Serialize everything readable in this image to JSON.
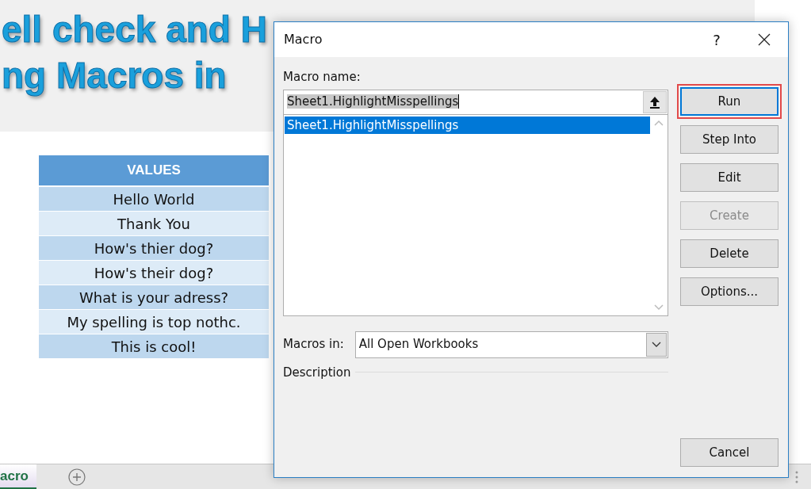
{
  "banner": {
    "lines": [
      "ell check and H",
      "ng Macros in"
    ]
  },
  "table": {
    "header": "VALUES",
    "rows": [
      "Hello World",
      "Thank You",
      "How's thier dog?",
      "How's their dog?",
      "What is your adress?",
      "My spelling is top nothc.",
      "This is cool!"
    ]
  },
  "sheet_tabs": [
    {
      "label": "acro",
      "selected": true
    }
  ],
  "dialog": {
    "title": "Macro",
    "help": "?",
    "macro_name_label": "Macro name:",
    "macro_name_value": "Sheet1.HighlightMisspellings",
    "macros": [
      {
        "label": "Sheet1.HighlightMisspellings",
        "selected": true
      }
    ],
    "buttons": [
      {
        "label": "Run",
        "disabled": false,
        "focused": true
      },
      {
        "label": "Step Into",
        "disabled": false,
        "focused": false
      },
      {
        "label": "Edit",
        "disabled": false,
        "focused": false
      },
      {
        "label": "Create",
        "disabled": true,
        "focused": false
      },
      {
        "label": "Delete",
        "disabled": false,
        "focused": false
      },
      {
        "label": "Options...",
        "disabled": false,
        "focused": false
      }
    ],
    "macros_in_label": "Macros in:",
    "macros_in_value": "All Open Workbooks",
    "description_label": "Description",
    "cancel": "Cancel"
  }
}
